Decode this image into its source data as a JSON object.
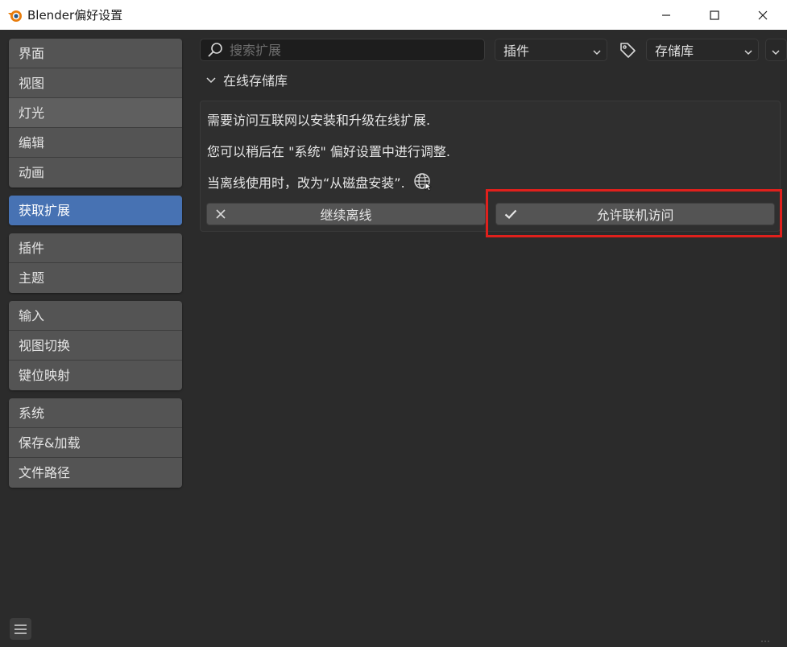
{
  "window": {
    "title": "Blender偏好设置"
  },
  "sidebar": {
    "groups": [
      {
        "items": [
          {
            "label": "界面"
          },
          {
            "label": "视图"
          },
          {
            "label": "灯光"
          },
          {
            "label": "编辑"
          },
          {
            "label": "动画"
          }
        ]
      },
      {
        "items": [
          {
            "label": "获取扩展"
          }
        ]
      },
      {
        "items": [
          {
            "label": "插件"
          },
          {
            "label": "主题"
          }
        ]
      },
      {
        "items": [
          {
            "label": "输入"
          },
          {
            "label": "视图切换"
          },
          {
            "label": "键位映射"
          }
        ]
      },
      {
        "items": [
          {
            "label": "系统"
          },
          {
            "label": "保存&加载"
          },
          {
            "label": "文件路径"
          }
        ]
      }
    ],
    "active_item": "获取扩展"
  },
  "toolbar": {
    "search_placeholder": "搜索扩展",
    "type_filter": "插件",
    "repository": "存储库"
  },
  "panel": {
    "header": "在线存储库",
    "lines": [
      "需要访问互联网以安装和升级在线扩展.",
      "您可以稍后在 \"系统\" 偏好设置中进行调整.",
      "当离线使用时，改为“从磁盘安装”."
    ],
    "offline_button": "继续离线",
    "online_button": "允许联机访问"
  },
  "colors": {
    "accent": "#4772b3",
    "highlight": "#e0201c"
  }
}
